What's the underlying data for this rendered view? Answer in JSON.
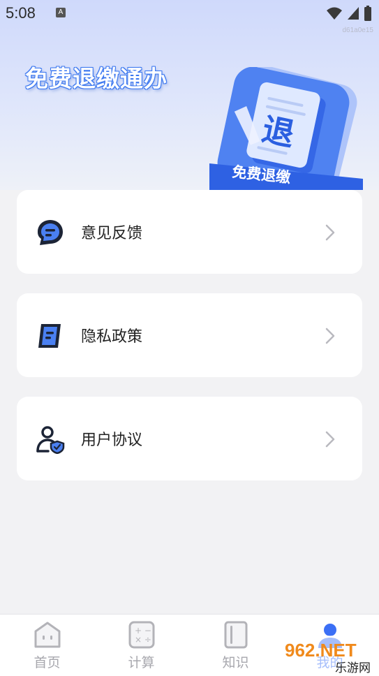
{
  "status_bar": {
    "time": "5:08",
    "notification_icon_letter": "A",
    "icons": [
      "wifi-icon",
      "signal-icon",
      "battery-icon"
    ]
  },
  "device_id": "d61a0e15",
  "banner": {
    "title": "免费退缴通办",
    "badge_char": "退",
    "badge_ribbon": "免费退缴"
  },
  "menu": [
    {
      "label": "意见反馈",
      "icon": "feedback-icon"
    },
    {
      "label": "隐私政策",
      "icon": "privacy-document-icon"
    },
    {
      "label": "用户协议",
      "icon": "user-shield-icon"
    }
  ],
  "tabbar": {
    "tabs": [
      {
        "label": "首页",
        "icon": "home-icon"
      },
      {
        "label": "计算",
        "icon": "calculator-icon"
      },
      {
        "label": "知识",
        "icon": "book-icon"
      },
      {
        "label": "我的",
        "icon": "profile-icon",
        "active": true
      }
    ]
  },
  "watermark": {
    "text": "962.NET",
    "subtitle": "乐游网"
  },
  "colors": {
    "accent": "#3b6ff5",
    "icon_dark": "#1c2436",
    "tab_inactive": "#a7a7ad"
  }
}
